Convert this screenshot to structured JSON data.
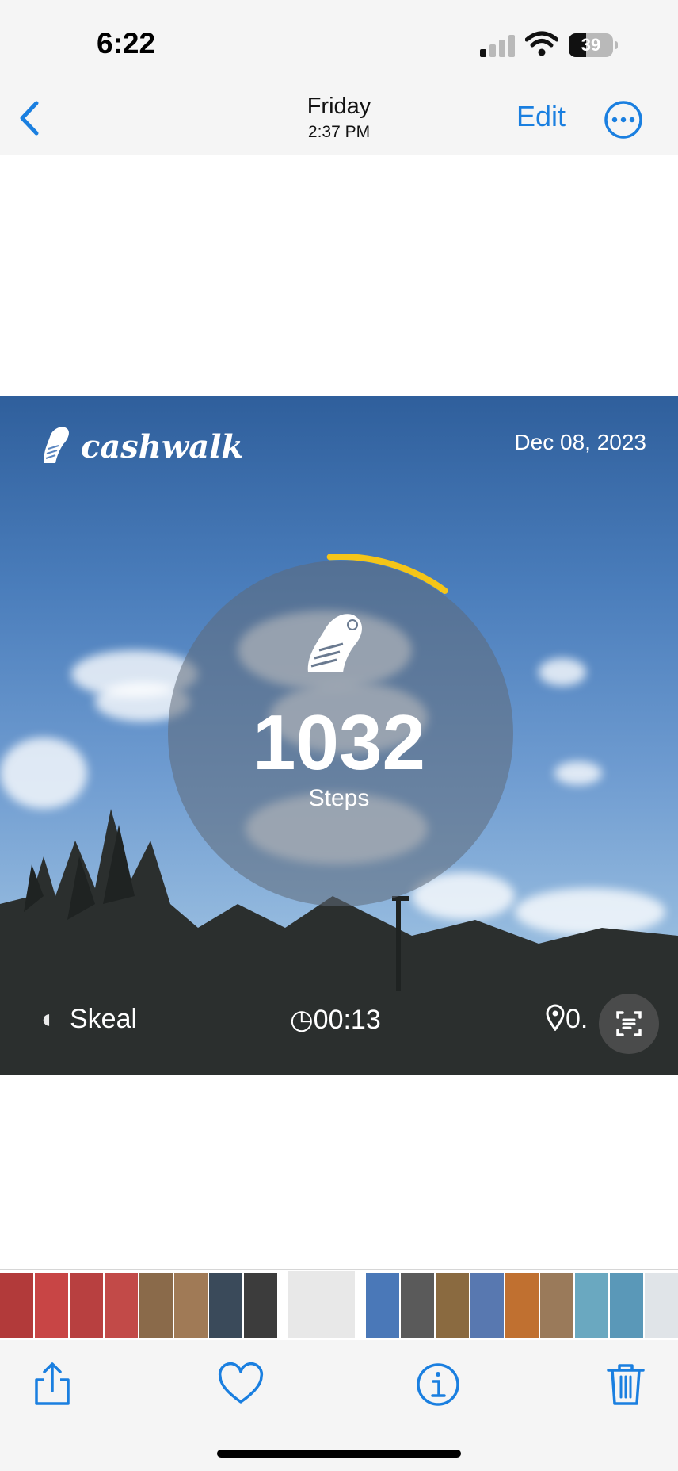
{
  "status": {
    "time": "6:22",
    "battery": "39",
    "battery_level": 0.39
  },
  "nav": {
    "back_icon": "chevron-left-icon",
    "title": "Friday",
    "subtitle": "2:37 PM",
    "edit_label": "Edit",
    "more_icon": "ellipsis-circle-icon",
    "accent": "#1a7fe0"
  },
  "photo": {
    "brand": "cashwalk",
    "date": "Dec 08, 2023",
    "steps": "1032",
    "steps_label": "Steps",
    "progress_fraction": 0.11,
    "progress_color": "#f5c518",
    "left_info": "Skeal",
    "time_info": "00:13",
    "distance_info": "0.",
    "scan_icon": "live-text-scan-icon"
  },
  "thumbnails": {
    "count": 20,
    "selected_index": 8
  },
  "toolbar": {
    "share_icon": "share-icon",
    "favorite_icon": "heart-icon",
    "info_icon": "info-icon",
    "delete_icon": "trash-icon"
  }
}
